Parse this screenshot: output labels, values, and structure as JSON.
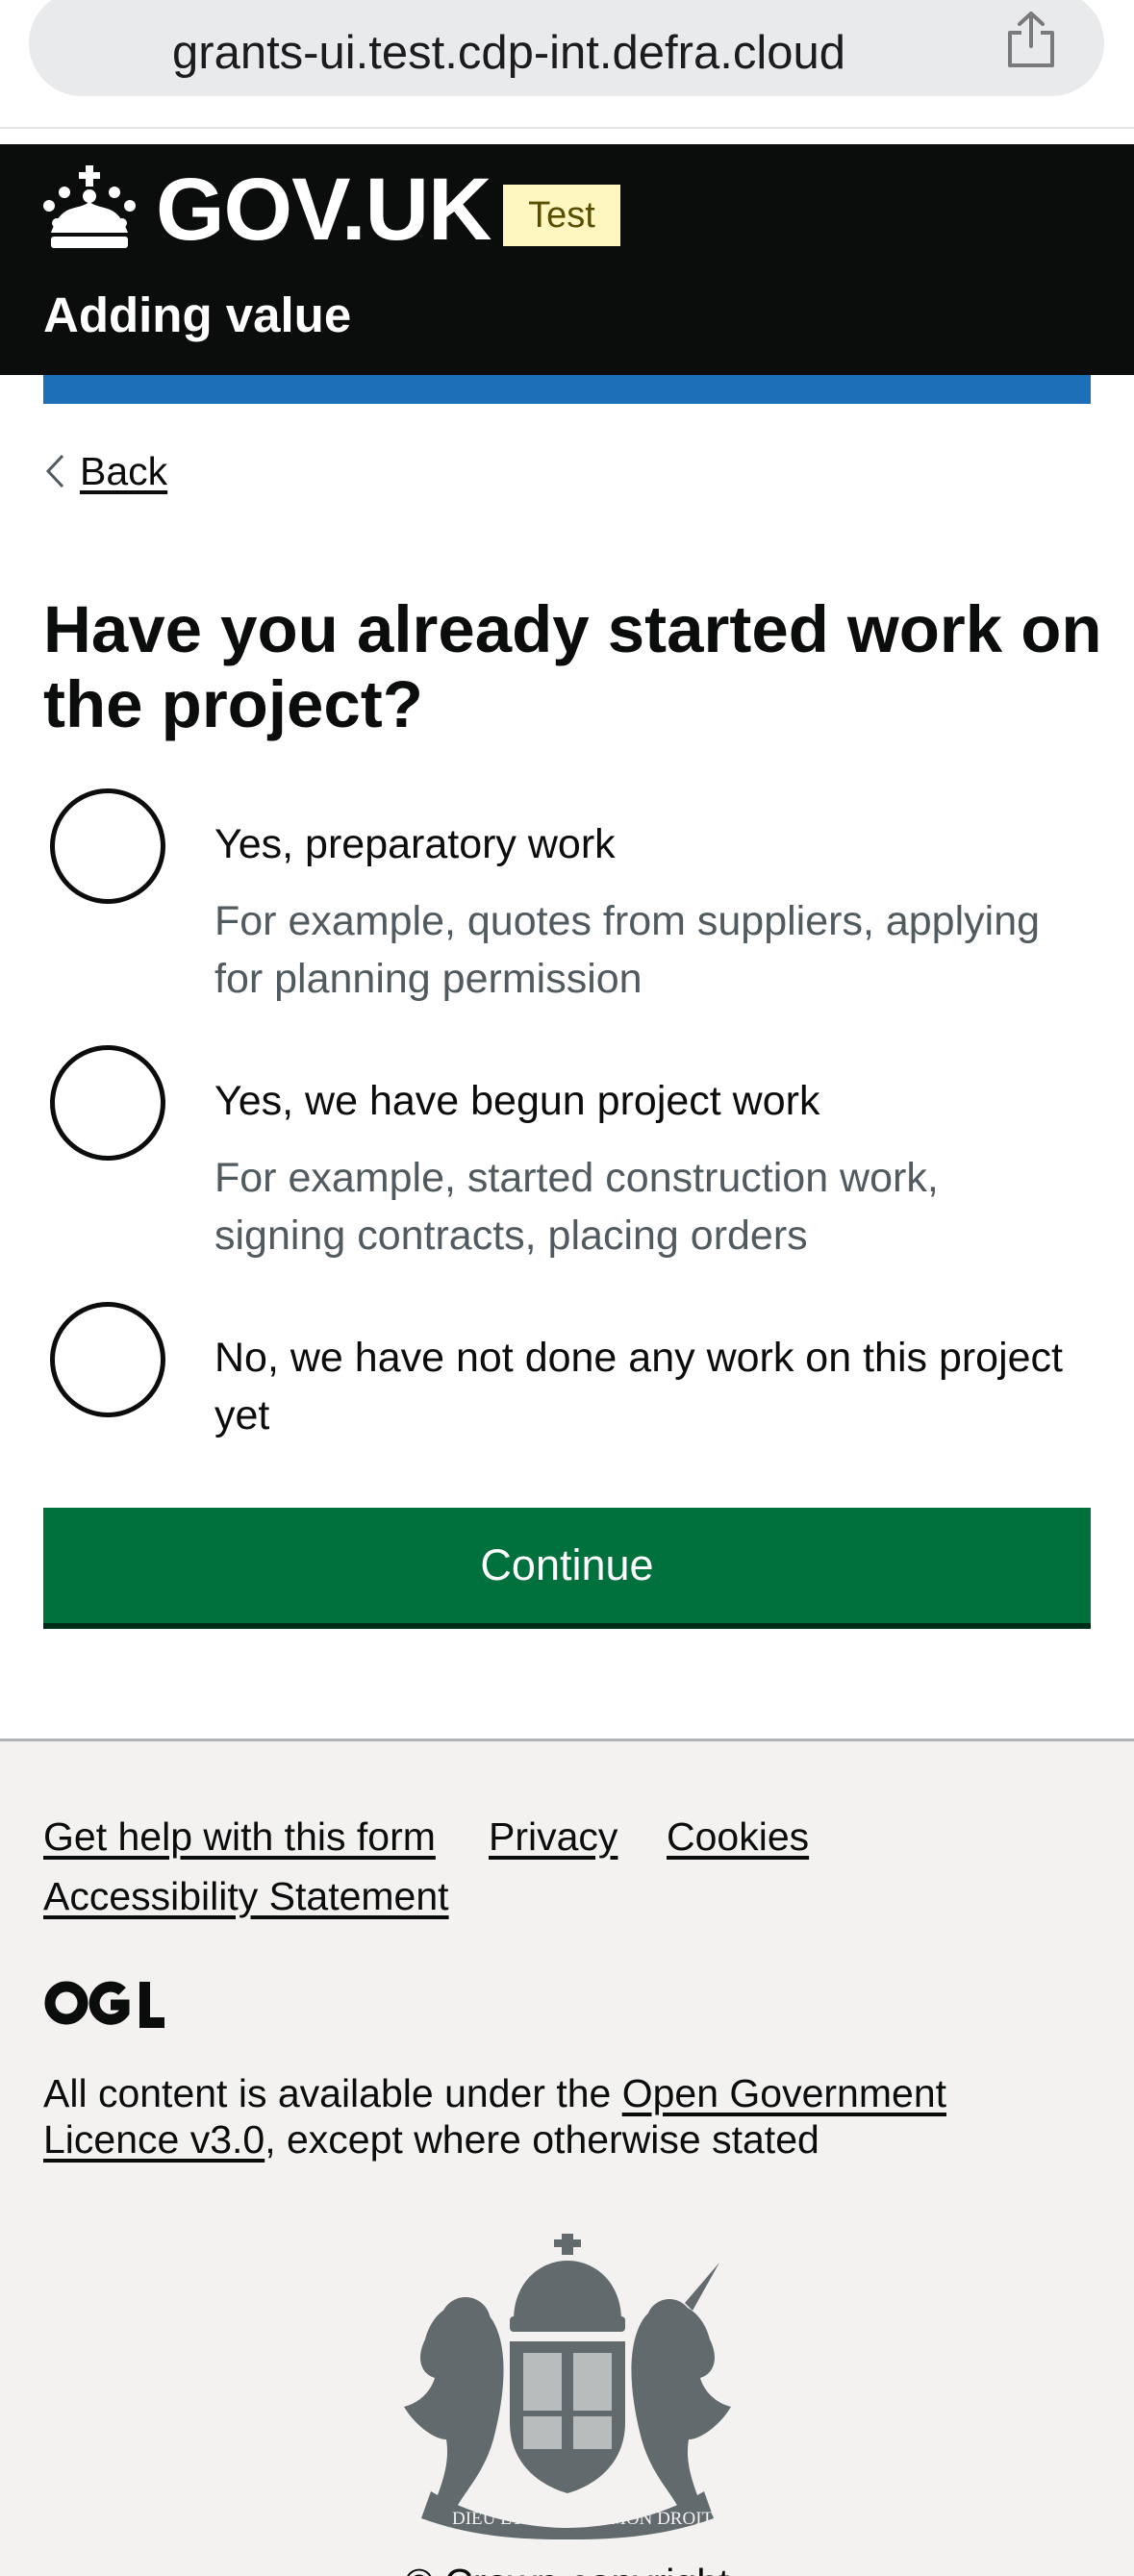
{
  "browser": {
    "url": "grants-ui.test.cdp-int.defra.cloud",
    "share_icon": "share-icon"
  },
  "header": {
    "logotype": "GOV.UK",
    "phase_tag": "Test",
    "service_name": "Adding value",
    "crown_icon": "crown-icon"
  },
  "main": {
    "back_label": "Back",
    "question": "Have you already started work on the project?",
    "options": [
      {
        "label": "Yes, preparatory work",
        "hint": "For example, quotes from suppliers, applying for planning permission"
      },
      {
        "label": "Yes, we have begun project work",
        "hint": "For example, started construction work, signing contracts, placing orders"
      },
      {
        "label": "No, we have not done any work on this project yet",
        "hint": ""
      }
    ],
    "continue_label": "Continue"
  },
  "footer": {
    "links": [
      "Get help with this form",
      "Privacy",
      "Cookies",
      "Accessibility Statement"
    ],
    "ogl_logo": "OGL",
    "licence_prefix": "All content is available under the ",
    "licence_link": "Open Government Licence v3.0",
    "licence_suffix": ", except where otherwise stated",
    "crest_motto_left": "DIEU ET",
    "crest_motto_right": "MON DROIT",
    "copyright": "© Crown copyright"
  },
  "colors": {
    "header_bg": "#0b0c0c",
    "blue_bar": "#1d70b8",
    "button_green": "#00703c",
    "tag_bg": "#fff7bf",
    "footer_bg": "#f3f2f1",
    "hint_text": "#505a5f"
  }
}
